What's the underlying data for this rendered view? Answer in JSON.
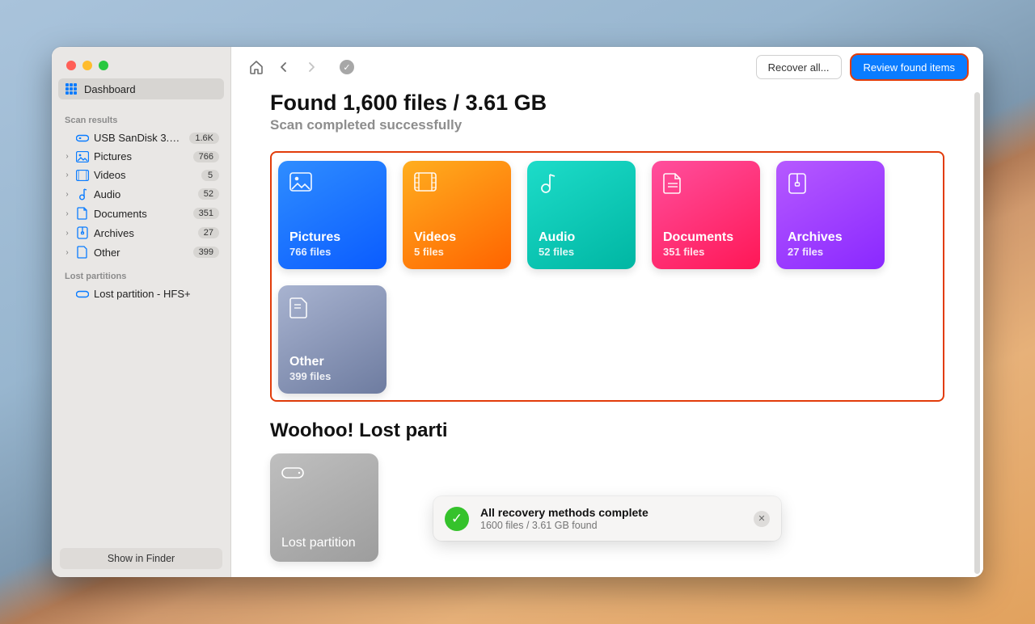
{
  "sidebar": {
    "dashboard_label": "Dashboard",
    "scan_results_label": "Scan results",
    "device": {
      "label": "USB  SanDisk 3.2…",
      "badge": "1.6K"
    },
    "tree": [
      {
        "key": "pictures",
        "label": "Pictures",
        "badge": "766"
      },
      {
        "key": "videos",
        "label": "Videos",
        "badge": "5"
      },
      {
        "key": "audio",
        "label": "Audio",
        "badge": "52"
      },
      {
        "key": "documents",
        "label": "Documents",
        "badge": "351"
      },
      {
        "key": "archives",
        "label": "Archives",
        "badge": "27"
      },
      {
        "key": "other",
        "label": "Other",
        "badge": "399"
      }
    ],
    "lost_label": "Lost partitions",
    "lost_item": "Lost partition - HFS+",
    "show_in_finder": "Show in Finder"
  },
  "toolbar": {
    "recover_all": "Recover all...",
    "review": "Review found items"
  },
  "main": {
    "heading": "Found 1,600 files / 3.61 GB",
    "subheading": "Scan completed successfully",
    "cards": [
      {
        "key": "pictures",
        "title": "Pictures",
        "sub": "766 files",
        "color": "blue"
      },
      {
        "key": "videos",
        "title": "Videos",
        "sub": "5 files",
        "color": "orange"
      },
      {
        "key": "audio",
        "title": "Audio",
        "sub": "52 files",
        "color": "teal"
      },
      {
        "key": "documents",
        "title": "Documents",
        "sub": "351 files",
        "color": "pink"
      },
      {
        "key": "archives",
        "title": "Archives",
        "sub": "27 files",
        "color": "purple"
      },
      {
        "key": "other",
        "title": "Other",
        "sub": "399 files",
        "color": "slate"
      }
    ],
    "woohoo": "Woohoo! Lost parti",
    "lost_card_title": "Lost partition"
  },
  "toast": {
    "line1": "All recovery methods complete",
    "line2": "1600 files / 3.61 GB found"
  }
}
